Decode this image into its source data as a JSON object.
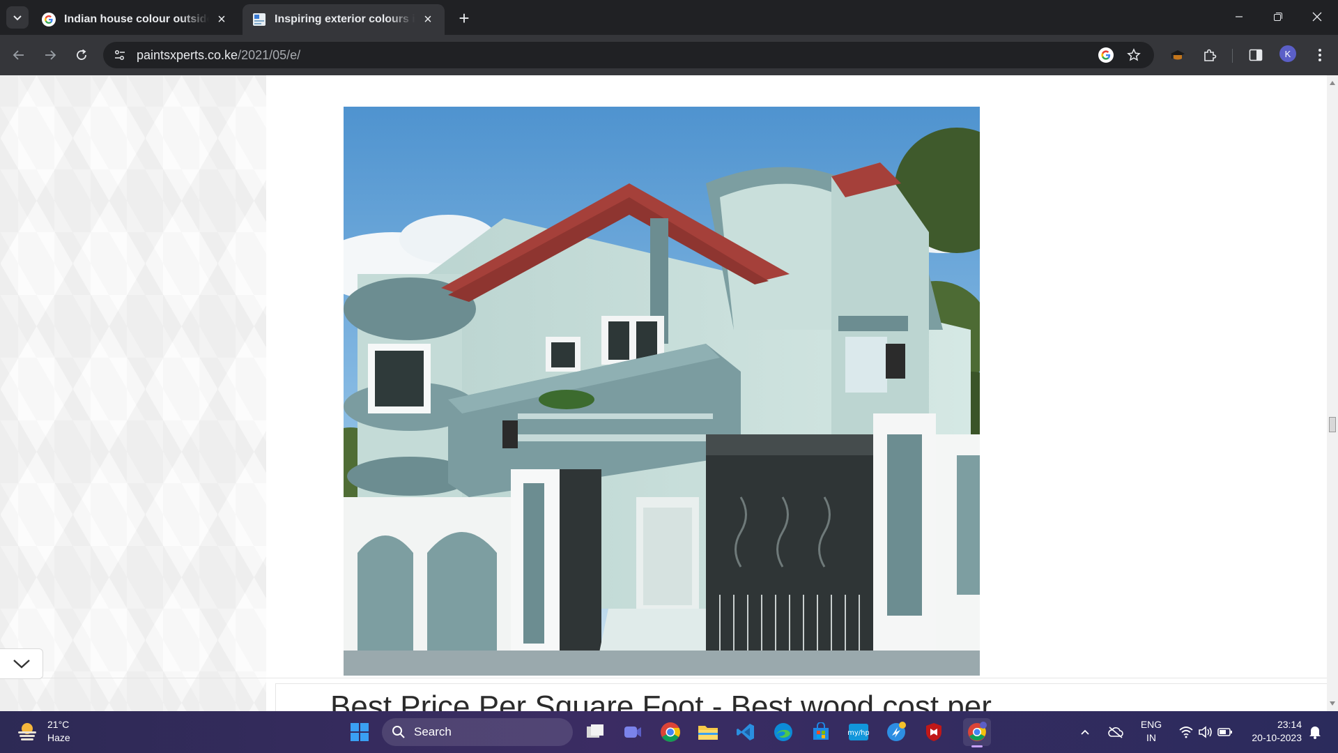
{
  "browser": {
    "tabs": [
      {
        "title": "Indian house colour outside co",
        "favicon": "google-g-icon",
        "active": false
      },
      {
        "title": "Inspiring exterior colours ideas",
        "favicon": "site-favicon-icon",
        "active": true
      }
    ],
    "address": {
      "domain": "paintsxperts.co.ke",
      "path": "/2021/05/e/"
    },
    "profile_initial": "K"
  },
  "page": {
    "hero_image_alt": "Two-storey house with sea-green walls, terracotta roof and dark iron gate",
    "heading_peek": "Best Price Per Square Foot - Best wood cost per"
  },
  "taskbar": {
    "weather": {
      "temp": "21°C",
      "condition": "Haze"
    },
    "search_label": "Search",
    "language": {
      "line1": "ENG",
      "line2": "IN"
    },
    "clock": {
      "time": "23:14",
      "date": "20-10-2023"
    },
    "apps": [
      "windows-start-icon",
      "task-view-icon",
      "teams-meet-icon",
      "chrome-icon",
      "file-explorer-icon",
      "vscode-icon",
      "edge-icon",
      "microsoft-store-icon",
      "myhp-icon",
      "hp-support-icon",
      "mcafee-icon",
      "chrome-profile-icon"
    ]
  },
  "colors": {
    "tabstrip": "#202124",
    "toolbar": "#35363a",
    "house_wall": "#cfe3df",
    "house_trim": "#6c8d91",
    "roof": "#a5403a",
    "gate": "#2f3536"
  }
}
